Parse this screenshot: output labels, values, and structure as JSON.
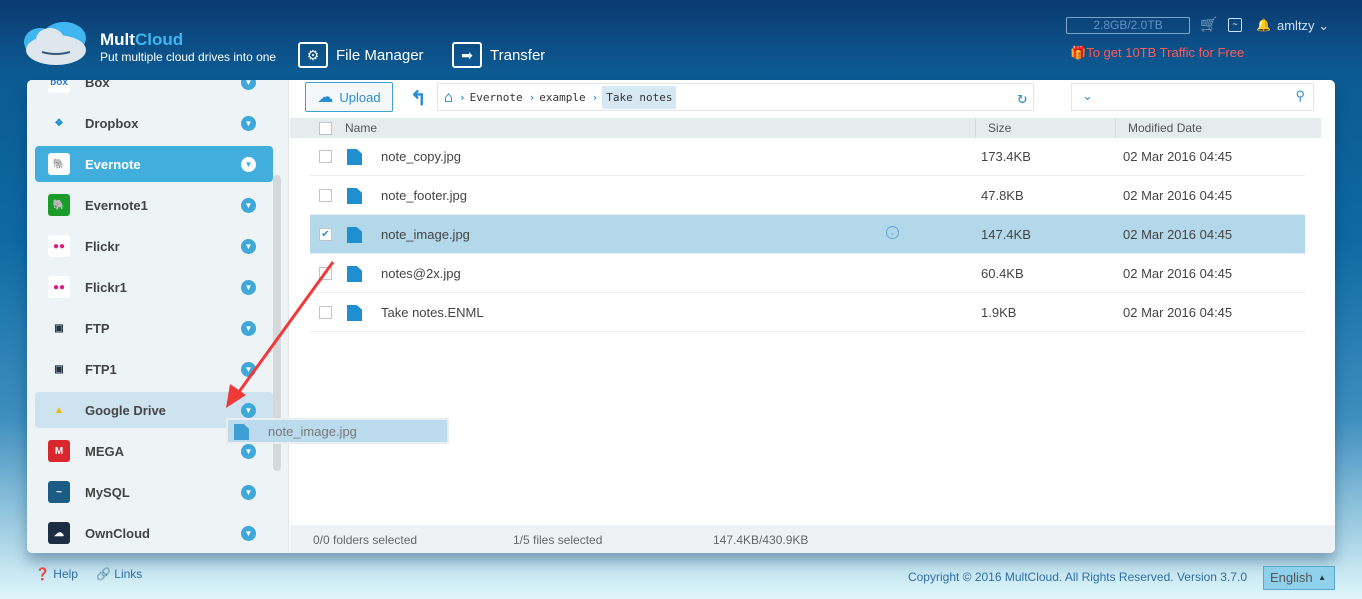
{
  "header": {
    "brand_a": "Mult",
    "brand_b": "Cloud",
    "tagline": "Put multiple cloud drives into one",
    "nav": [
      {
        "label": "File Manager",
        "icon": "gear-icon"
      },
      {
        "label": "Transfer",
        "icon": "arrow-right-icon"
      }
    ],
    "quota": "2.8GB/2.0TB",
    "user": "amltzy",
    "promo": "To get 10TB Traffic for Free"
  },
  "sidebar": {
    "items": [
      {
        "label": "Box",
        "icon": "box"
      },
      {
        "label": "Dropbox",
        "icon": "dropbox"
      },
      {
        "label": "Evernote",
        "icon": "evernote"
      },
      {
        "label": "Evernote1",
        "icon": "evernote"
      },
      {
        "label": "Flickr",
        "icon": "flickr"
      },
      {
        "label": "Flickr1",
        "icon": "flickr"
      },
      {
        "label": "FTP",
        "icon": "ftp"
      },
      {
        "label": "FTP1",
        "icon": "ftp"
      },
      {
        "label": "Google Drive",
        "icon": "google-drive"
      },
      {
        "label": "MEGA",
        "icon": "mega"
      },
      {
        "label": "MySQL",
        "icon": "mysql"
      },
      {
        "label": "OwnCloud",
        "icon": "owncloud"
      }
    ]
  },
  "toolbar": {
    "upload": "Upload",
    "breadcrumb": [
      "Evernote",
      "example",
      "Take notes"
    ]
  },
  "table": {
    "headers": {
      "name": "Name",
      "size": "Size",
      "date": "Modified Date"
    },
    "rows": [
      {
        "name": "note_copy.jpg",
        "size": "173.4KB",
        "date": "02 Mar 2016 04:45",
        "checked": false
      },
      {
        "name": "note_footer.jpg",
        "size": "47.8KB",
        "date": "02 Mar 2016 04:45",
        "checked": false
      },
      {
        "name": "note_image.jpg",
        "size": "147.4KB",
        "date": "02 Mar 2016 04:45",
        "checked": true
      },
      {
        "name": "notes@2x.jpg",
        "size": "60.4KB",
        "date": "02 Mar 2016 04:45",
        "checked": false
      },
      {
        "name": "Take notes.ENML",
        "size": "1.9KB",
        "date": "02 Mar 2016 04:45",
        "checked": false
      }
    ]
  },
  "status": {
    "folders": "0/0 folders selected",
    "files": "1/5 files selected",
    "size": "147.4KB/430.9KB"
  },
  "drag": {
    "label": "note_image.jpg"
  },
  "footer": {
    "help": "Help",
    "links": "Links",
    "copyright": "Copyright © 2016 MultCloud. All Rights Reserved. Version 3.7.0",
    "language": "English"
  },
  "colors": {
    "accent": "#42aede",
    "promo": "#ff5a5a",
    "selected_row": "#b3d8ea"
  }
}
